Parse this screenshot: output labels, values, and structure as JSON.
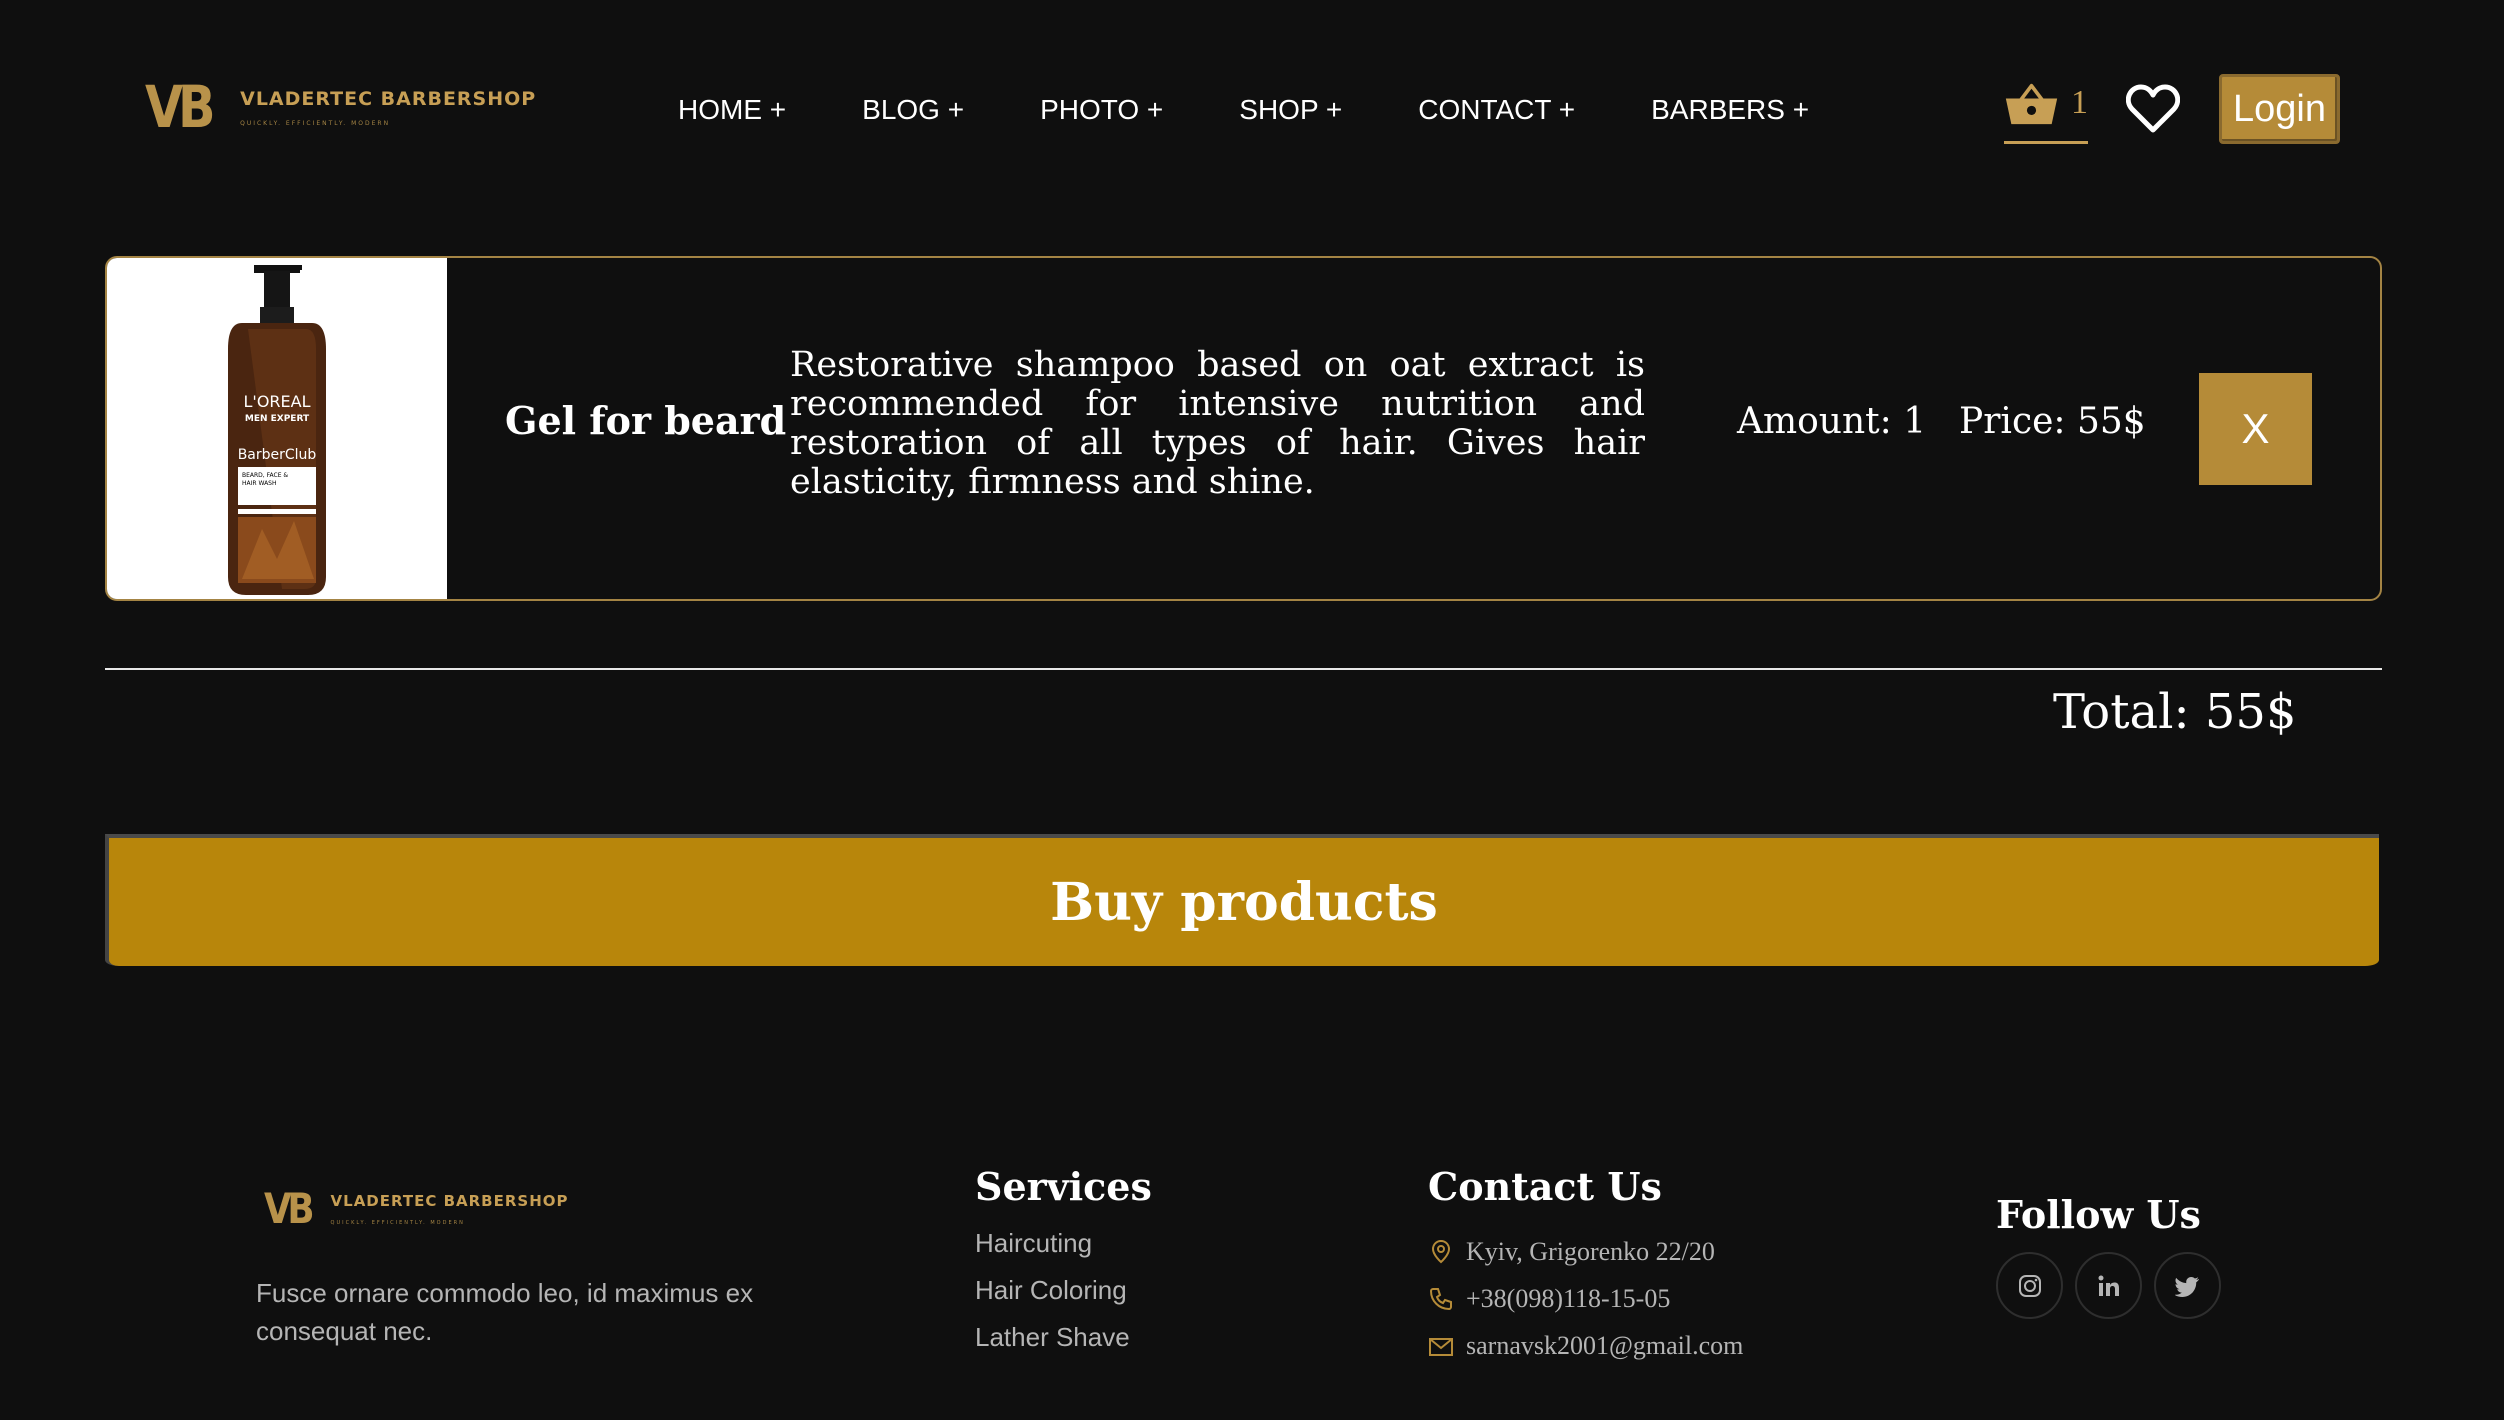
{
  "header": {
    "logo_mono": "VB",
    "logo_name": "VLADERTEC BARBERSHOP",
    "logo_tagline": "QUICKLY. EFFICIENTLY. MODERN",
    "nav": [
      {
        "label": "HOME +"
      },
      {
        "label": "BLOG +"
      },
      {
        "label": "PHOTO +"
      },
      {
        "label": "SHOP +"
      },
      {
        "label": "CONTACT +"
      },
      {
        "label": "BARBERS +"
      }
    ],
    "cart_count": "1",
    "login_label": "Login"
  },
  "cart_item": {
    "image": "loreal-barberclub-bottle",
    "brand": "L'OREAL",
    "brand_sub": "MEN EXPERT",
    "name": "Gel for beard",
    "description": "Restorative shampoo based on oat extract is recommended for intensive nutrition and restoration of all types of hair. Gives hair elasticity, firmness and shine.",
    "amount": "Amount: 1",
    "price": "Price: 55$",
    "remove_label": "X"
  },
  "total": "Total: 55$",
  "buy_label": "Buy products",
  "footer": {
    "logo_mono": "VB",
    "logo_name": "VLADERTEC BARBERSHOP",
    "logo_tagline": "QUICKLY. EFFICIENTLY. MODERN",
    "about": "Fusce ornare commodo leo, id maximus ex consequat nec.",
    "services_title": "Services",
    "services": [
      {
        "label": "Haircuting"
      },
      {
        "label": "Hair Coloring"
      },
      {
        "label": "Lather Shave"
      }
    ],
    "contact_title": "Contact Us",
    "contacts": [
      {
        "icon": "location-pin-icon",
        "text": "Kyiv, Grigorenko 22/20"
      },
      {
        "icon": "phone-icon",
        "text": "+38(098)118-15-05"
      },
      {
        "icon": "envelope-icon",
        "text": "sarnavsk2001@gmail.com"
      }
    ],
    "follow_title": "Follow Us",
    "socials": [
      "instagram-icon",
      "linkedin-icon",
      "twitter-icon"
    ]
  },
  "colors": {
    "background": "#0f0f0f",
    "gold": "#b58b38",
    "gold_text": "#c79f55",
    "buy_button": "#b8860b",
    "muted_text": "#b5b5b5"
  }
}
